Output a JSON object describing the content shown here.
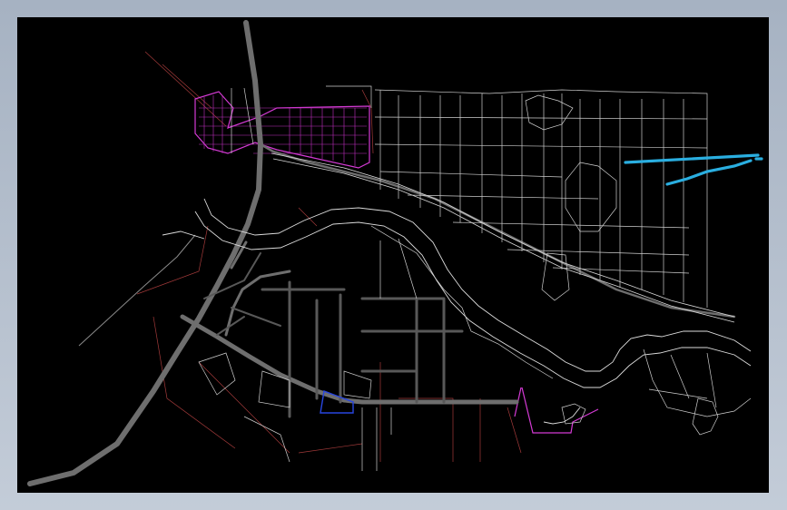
{
  "map": {
    "background_color": "#000000",
    "frame_color": "#b3bdcb",
    "layer_colors": {
      "major_road": "#6e6e6e",
      "parcel_outline": "#cfcfcf",
      "red_boundary": "#a33a3a",
      "planning_zone": "#d43ad4",
      "water_feature": "#2aaee0",
      "highlight_boundary": "#2846e0"
    }
  }
}
